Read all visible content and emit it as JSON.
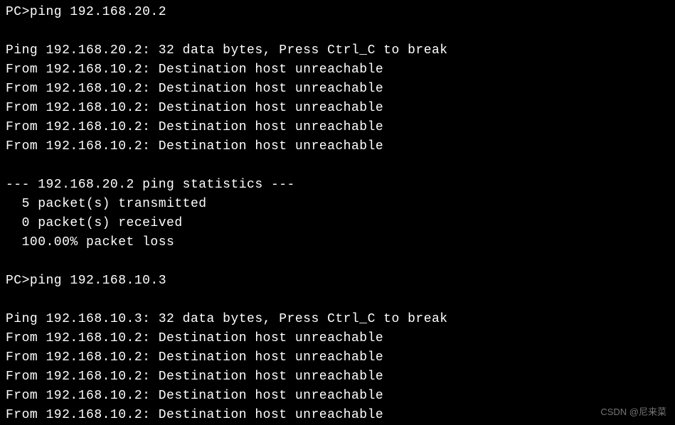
{
  "terminal": {
    "prompt": "PC>",
    "session1": {
      "command": "ping 192.168.20.2",
      "header": "Ping 192.168.20.2: 32 data bytes, Press Ctrl_C to break",
      "replies": [
        "From 192.168.10.2: Destination host unreachable",
        "From 192.168.10.2: Destination host unreachable",
        "From 192.168.10.2: Destination host unreachable",
        "From 192.168.10.2: Destination host unreachable",
        "From 192.168.10.2: Destination host unreachable"
      ],
      "stats_header": "--- 192.168.20.2 ping statistics ---",
      "stats_tx": "  5 packet(s) transmitted",
      "stats_rx": "  0 packet(s) received",
      "stats_loss": "  100.00% packet loss"
    },
    "session2": {
      "command": "ping 192.168.10.3",
      "header": "Ping 192.168.10.3: 32 data bytes, Press Ctrl_C to break",
      "replies": [
        "From 192.168.10.2: Destination host unreachable",
        "From 192.168.10.2: Destination host unreachable",
        "From 192.168.10.2: Destination host unreachable",
        "From 192.168.10.2: Destination host unreachable",
        "From 192.168.10.2: Destination host unreachable"
      ]
    }
  },
  "watermark": "CSDN @尼来菜",
  "watermark_faint": ""
}
